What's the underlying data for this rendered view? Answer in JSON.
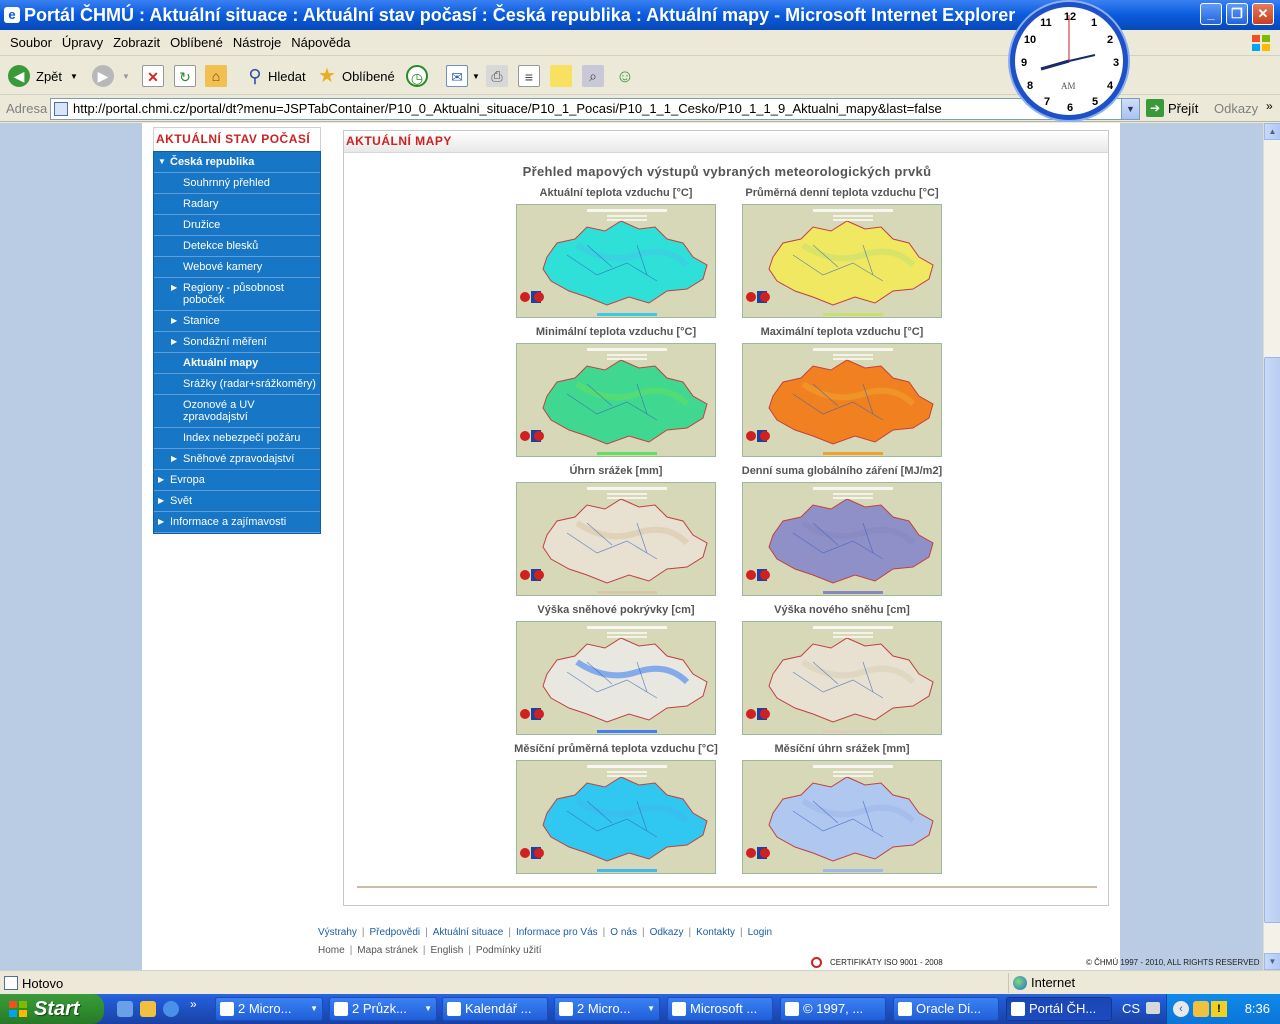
{
  "window": {
    "title": "Portál ČHMÚ : Aktuální situace : Aktuální stav počasí : Česká republika : Aktuální mapy - Microsoft Internet Explorer"
  },
  "menu": [
    "Soubor",
    "Úpravy",
    "Zobrazit",
    "Oblíbené",
    "Nástroje",
    "Nápověda"
  ],
  "toolbar": {
    "back": "Zpět",
    "search": "Hledat",
    "favorites": "Oblíbené"
  },
  "address": {
    "label": "Adresa",
    "url": "http://portal.chmi.cz/portal/dt?menu=JSPTabContainer/P10_0_Aktualni_situace/P10_1_Pocasi/P10_1_1_Cesko/P10_1_1_9_Aktualni_mapy&last=false",
    "go": "Přejít",
    "links": "Odkazy"
  },
  "clock": {
    "numbers": [
      "12",
      "1",
      "2",
      "3",
      "4",
      "5",
      "6",
      "7",
      "8",
      "9",
      "10",
      "11"
    ],
    "ampm": "AM"
  },
  "nav": {
    "header": "AKTUÁLNÍ STAV POČASÍ",
    "items": [
      {
        "label": "Česká republika",
        "level": "top",
        "arrow": "▼",
        "active": true
      },
      {
        "label": "Souhrnný přehled",
        "level": "sub"
      },
      {
        "label": "Radary",
        "level": "sub"
      },
      {
        "label": "Družice",
        "level": "sub"
      },
      {
        "label": "Detekce blesků",
        "level": "sub"
      },
      {
        "label": "Webové kamery",
        "level": "sub"
      },
      {
        "label": "Regiony - působnost poboček",
        "level": "sub",
        "arrow": "▶"
      },
      {
        "label": "Stanice",
        "level": "sub",
        "arrow": "▶"
      },
      {
        "label": "Sondážní měření",
        "level": "sub",
        "arrow": "▶"
      },
      {
        "label": "Aktuální mapy",
        "level": "sub",
        "active": true
      },
      {
        "label": "Srážky (radar+srážkoměry)",
        "level": "sub"
      },
      {
        "label": "Ozonové a UV zpravodajství",
        "level": "sub"
      },
      {
        "label": "Index nebezpečí požáru",
        "level": "sub"
      },
      {
        "label": "Sněhové zpravodajství",
        "level": "sub",
        "arrow": "▶"
      },
      {
        "label": "Evropa",
        "level": "top",
        "arrow": "▶"
      },
      {
        "label": "Svět",
        "level": "top",
        "arrow": "▶"
      },
      {
        "label": "Informace a zajímavosti",
        "level": "top",
        "arrow": "▶"
      }
    ]
  },
  "main": {
    "header": "AKTUÁLNÍ MAPY",
    "subtitle": "Přehled mapových výstupů vybraných meteorologických prvků",
    "maps": [
      {
        "label": "Aktuální teplota vzduchu [°C]",
        "color": "#2FE0D8",
        "accent": "#40C8E8"
      },
      {
        "label": "Průměrná denní teplota vzduchu [°C]",
        "color": "#F0E860",
        "accent": "#C8E070"
      },
      {
        "label": "Minimální teplota vzduchu [°C]",
        "color": "#40D890",
        "accent": "#60E060"
      },
      {
        "label": "Maximální teplota vzduchu [°C]",
        "color": "#F08020",
        "accent": "#F0A030"
      },
      {
        "label": "Úhrn srážek [mm]",
        "color": "#E8E0D0",
        "accent": "#D8C8A8"
      },
      {
        "label": "Denní suma globálního záření [MJ/m2]",
        "color": "#9090C8",
        "accent": "#8888C0"
      },
      {
        "label": "Výška sněhové pokrývky [cm]",
        "color": "#E8E8E0",
        "accent": "#4080F0"
      },
      {
        "label": "Výška nového sněhu [cm]",
        "color": "#E8E0D0",
        "accent": "#D8D0B8"
      },
      {
        "label": "Měsíční průměrná teplota vzduchu [°C]",
        "color": "#30C8F0",
        "accent": "#40B8F0"
      },
      {
        "label": "Měsíční úhrn srážek [mm]",
        "color": "#B0C8F0",
        "accent": "#A0B8E8"
      }
    ]
  },
  "footer": {
    "links": [
      "Výstrahy",
      "Předpovědi",
      "Aktuální situace",
      "Informace pro Vás",
      "O nás",
      "Odkazy",
      "Kontakty",
      "Login"
    ],
    "links2": [
      "Home",
      "Mapa stránek",
      "English",
      "Podmínky užití"
    ],
    "cert": "CERTIFIKÁTY   ISO   9001 - 2008",
    "copyright": "© ČHMÚ 1997 - 2010,  ALL RIGHTS RESERVED"
  },
  "status": {
    "text": "Hotovo",
    "zone": "Internet"
  },
  "taskbar": {
    "start": "Start",
    "tasks": [
      "2 Micro...",
      "2 Průzk...",
      "Kalendář ...",
      "2 Micro...",
      "Microsoft ...",
      "© 1997, ...",
      "Oracle Di...",
      "Portál ČH..."
    ],
    "lang": "CS",
    "time": "8:36"
  }
}
